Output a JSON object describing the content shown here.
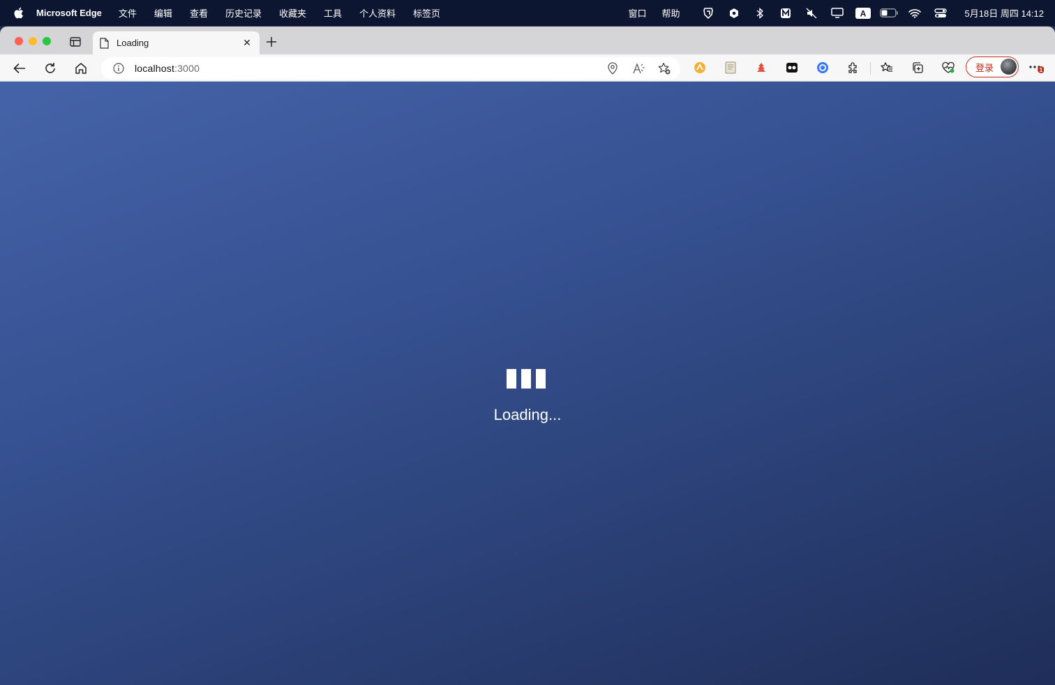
{
  "menubar": {
    "app_name": "Microsoft Edge",
    "menus": [
      "文件",
      "编辑",
      "查看",
      "历史记录",
      "收藏夹",
      "工具",
      "个人资料",
      "标签页"
    ],
    "right_menus": [
      "窗口",
      "帮助"
    ],
    "tray_icons": [
      "guard-icon",
      "shield-icon",
      "bluetooth-icon",
      "m-app-icon",
      "mute-icon",
      "display-icon",
      "input-method-icon",
      "battery-icon",
      "wifi-icon",
      "control-center-icon"
    ],
    "input_method": "A",
    "datetime": "5月18日 周四 14:12"
  },
  "tab": {
    "title": "Loading",
    "close_label": "✕"
  },
  "address_bar": {
    "host": "localhost",
    "port": ":3000"
  },
  "toolbar": {
    "login_label": "登录",
    "notification_count": "1"
  },
  "page": {
    "loading_text": "Loading...",
    "background_start": "#4563a9",
    "background_end": "#1f2e59"
  }
}
